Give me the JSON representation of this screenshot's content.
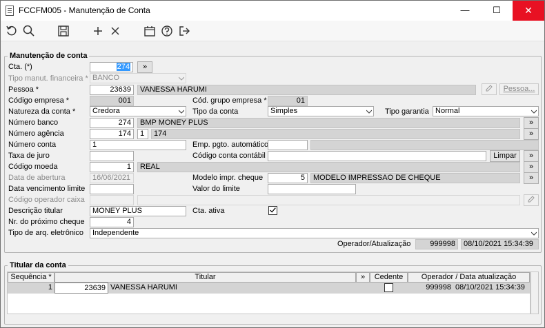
{
  "window": {
    "title": "FCCFM005 - Manutenção de Conta",
    "minimize": "—",
    "maximize": "☐",
    "close": "✕"
  },
  "toolbar": {
    "icons": [
      "refresh-icon",
      "search-icon",
      "save-icon",
      "add-icon",
      "cancel-icon",
      "calendar-icon",
      "help-icon",
      "exit-icon"
    ]
  },
  "form": {
    "section_title": "Manutenção de conta",
    "cta_label": "Cta. (*)",
    "cta_value": "274",
    "cta_button": "»",
    "tipo_manut_label": "Tipo manut. financeira *",
    "tipo_manut_value": "BANCO",
    "pessoa_label": "Pessoa *",
    "pessoa_code": "23639",
    "pessoa_name": "VANESSA HARUMI",
    "pessoa_button": "Pessoa...",
    "cod_empresa_label": "Código empresa *",
    "cod_empresa_value": "001",
    "cod_grupo_label": "Cód. grupo empresa *",
    "cod_grupo_value": "01",
    "natureza_label": "Natureza da conta *",
    "natureza_value": "Credora",
    "tipo_conta_label": "Tipo da conta",
    "tipo_conta_value": "Simples",
    "tipo_garantia_label": "Tipo garantia",
    "tipo_garantia_value": "Normal",
    "banco_label": "Número banco",
    "banco_code": "274",
    "banco_name": "BMP MONEY PLUS",
    "agencia_label": "Número agência",
    "agencia_code": "174",
    "agencia_digit": "1",
    "agencia_name": "174",
    "conta_label": "Número conta",
    "conta_value": "1",
    "emp_pgto_label": "Emp. pgto. automático",
    "emp_pgto_value": "",
    "taxa_label": "Taxa de juro",
    "taxa_value": "",
    "cod_contabil_label": "Código conta contábil",
    "cod_contabil_value": "",
    "limpar_button": "Limpar",
    "moeda_label": "Código moeda",
    "moeda_code": "1",
    "moeda_name": "REAL",
    "abertura_label": "Data de abertura",
    "abertura_value": "16/06/2021",
    "modelo_label": "Modelo impr. cheque",
    "modelo_code": "5",
    "modelo_name": "MODELO IMPRESSAO DE CHEQUE",
    "venc_label": "Data vencimento limite",
    "venc_value": "",
    "valor_limite_label": "Valor do limite",
    "valor_limite_value": "",
    "operador_caixa_label": "Código operador caixa",
    "operador_caixa_value": "",
    "descricao_label": "Descrição titular",
    "descricao_value": "MONEY PLUS",
    "cta_ativa_label": "Cta. ativa",
    "cta_ativa_checked": true,
    "prox_cheque_label": "Nr. do próximo cheque",
    "prox_cheque_value": "4",
    "tipo_arq_label": "Tipo de arq. eletrônico",
    "tipo_arq_value": "Independente",
    "oper_atual_label": "Operador/Atualização",
    "oper_atual_user": "999998",
    "oper_atual_date": "08/10/2021 15:34:39"
  },
  "titular": {
    "section_title": "Titular da conta",
    "columns": [
      "Sequência *",
      "Titular",
      "»",
      "Cedente",
      "Operador / Data atualização"
    ],
    "rows": [
      {
        "sequencia": "1",
        "codigo": "23639",
        "nome": "VANESSA HARUMI",
        "cedente": false,
        "operador": "999998",
        "data": "08/10/2021 15:34:39"
      }
    ]
  }
}
